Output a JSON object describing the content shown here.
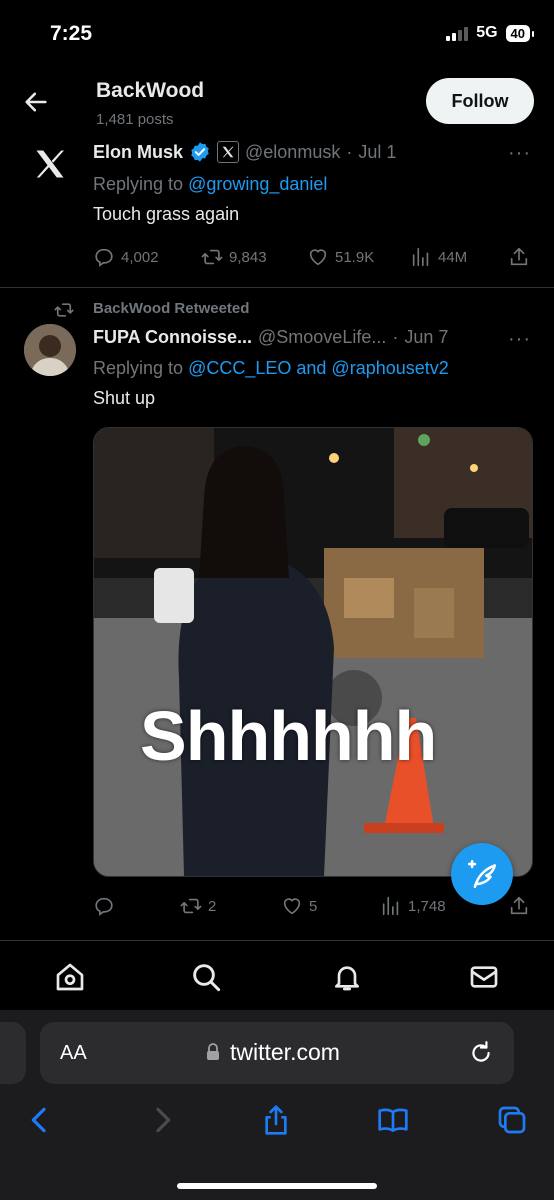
{
  "status": {
    "time": "7:25",
    "network": "5G",
    "battery": "40"
  },
  "header": {
    "title": "BackWood",
    "posts": "1,481 posts",
    "follow_label": "Follow"
  },
  "tweet1": {
    "name": "Elon Musk",
    "handle": "@elonmusk",
    "dot": "·",
    "date": "Jul 1",
    "replying_prefix": "Replying to ",
    "replying_to": "@growing_daniel",
    "text": "Touch grass again",
    "replies": "4,002",
    "retweets": "9,843",
    "likes": "51.9K",
    "views": "44M"
  },
  "retweet_banner": "BackWood Retweeted",
  "tweet2": {
    "name": "FUPA Connoisse...",
    "handle": "@SmooveLife...",
    "dot": "·",
    "date": "Jun 7",
    "replying_prefix": "Replying to ",
    "replying_to_1": "@CCC_LEO",
    "replying_and": " and ",
    "replying_to_2": "@raphousetv2",
    "text": "Shut up",
    "media_caption": "Shhhhhh",
    "replies": "",
    "retweets": "2",
    "likes": "5",
    "views": "1,748"
  },
  "browser": {
    "aa_label": "AA",
    "url": "twitter.com"
  },
  "icons": {
    "back": "arrow-left-icon",
    "x_logo": "x-logo-icon",
    "verified": "verified-badge-icon",
    "compose": "compose-post-icon",
    "home": "home-icon",
    "search": "search-icon",
    "notifications": "bell-icon",
    "messages": "mail-icon"
  },
  "colors": {
    "accent": "#1d9bf0",
    "muted": "#71767b",
    "background": "#000000"
  }
}
